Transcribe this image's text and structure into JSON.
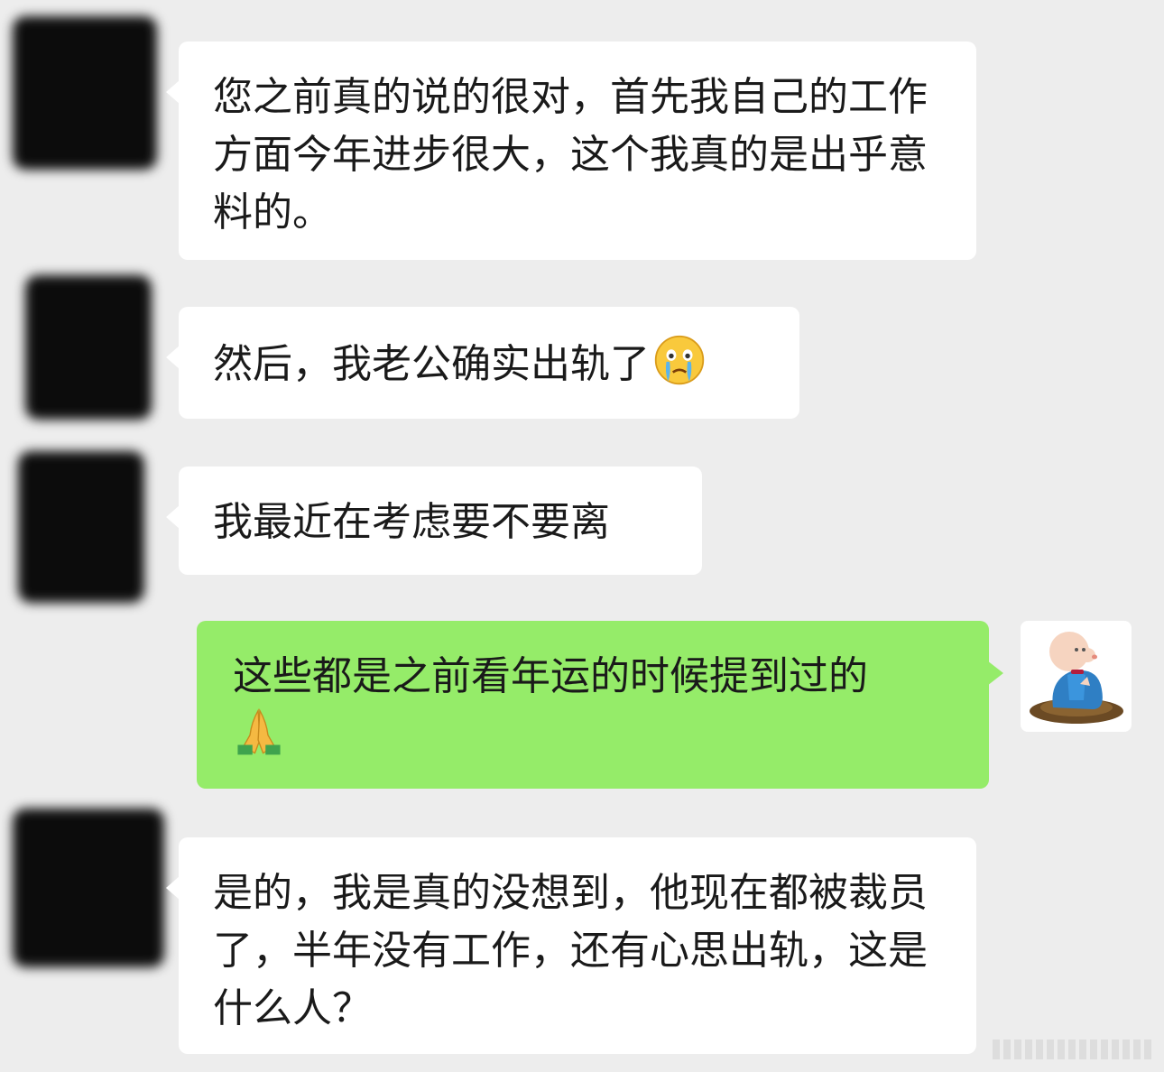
{
  "messages": [
    {
      "side": "left",
      "text": "您之前真的说的很对，首先我自己的工作方面今年进步很大，这个我真的是出乎意料的。"
    },
    {
      "side": "left",
      "text": "然后，我老公确实出轨了",
      "emoji": "crying-face-icon"
    },
    {
      "side": "left",
      "text": "我最近在考虑要不要离"
    },
    {
      "side": "right",
      "text": "这些都是之前看年运的时候提到过的",
      "emoji": "folded-hands-icon"
    },
    {
      "side": "left",
      "text": "是的，我是真的没想到，他现在都被裁员了，半年没有工作，还有心思出轨，这是什么人？"
    }
  ],
  "colors": {
    "background": "#ededed",
    "incoming_bubble": "#ffffff",
    "outgoing_bubble": "#95ec69",
    "text": "#1a1a1a"
  }
}
